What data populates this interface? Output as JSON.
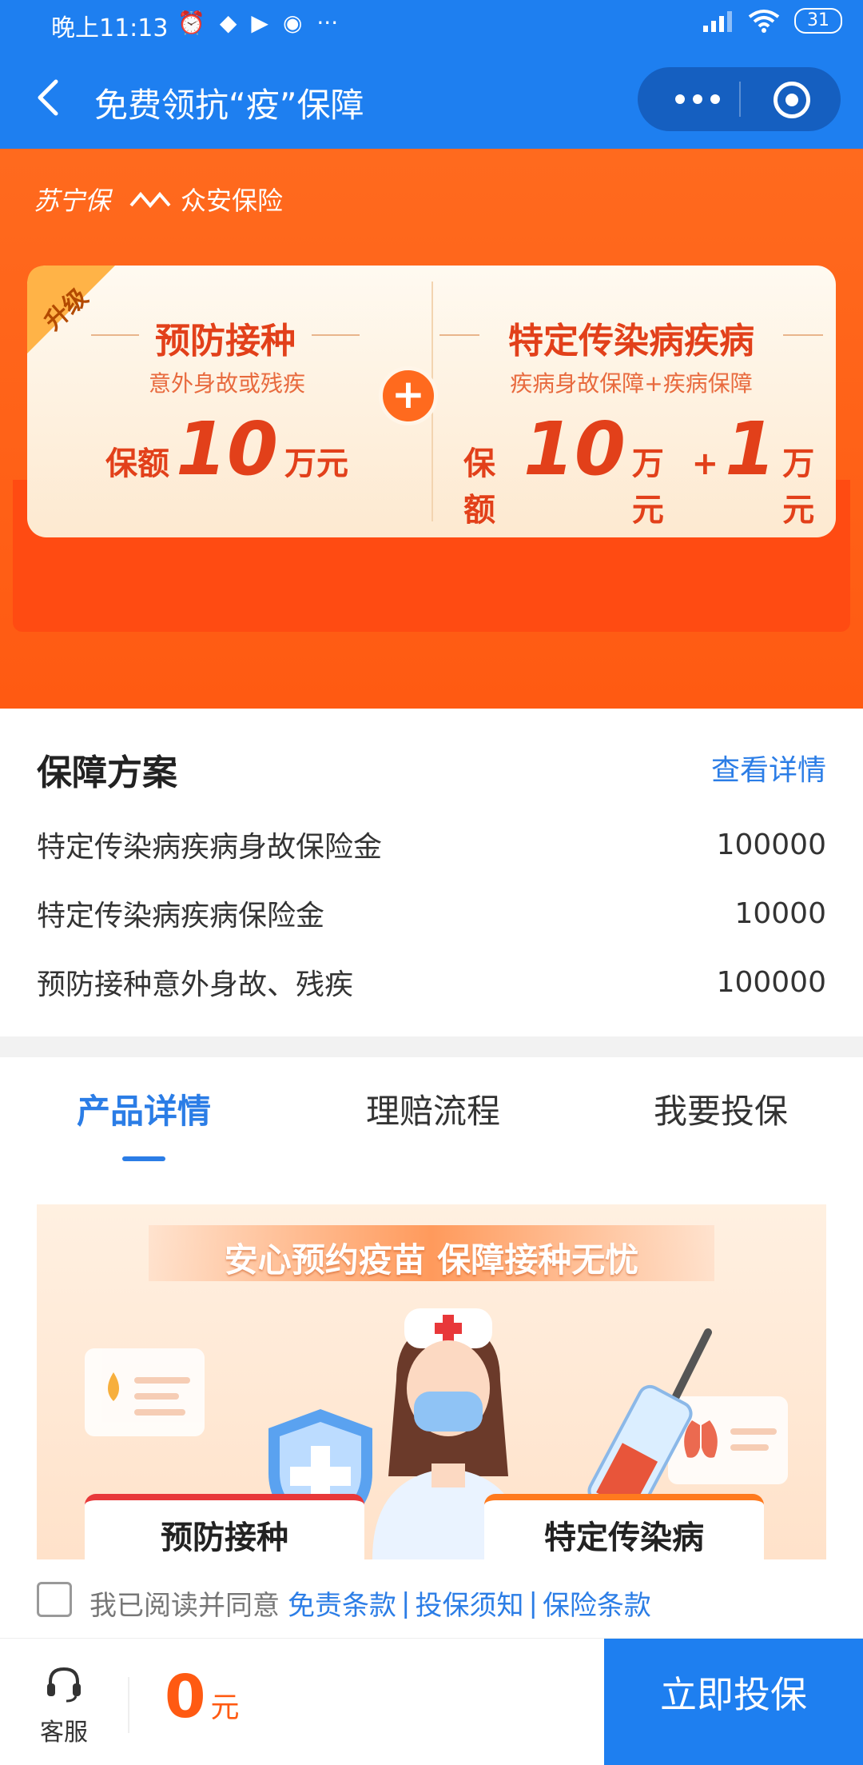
{
  "status_bar": {
    "time": "晚上11:13",
    "more": "···",
    "battery": "31"
  },
  "nav": {
    "title": "免费领抗“疫”保障"
  },
  "banner": {
    "brand_suning": "苏宁保",
    "brand_zhongan": "众安保险",
    "badge": "升级",
    "left": {
      "title": "预防接种",
      "subtitle": "意外身故或残疾",
      "amount_prefix": "保额",
      "amount": "10",
      "unit": "万元"
    },
    "plus": "+",
    "right": {
      "title": "特定传染病疾病",
      "subtitle": "疾病身故保障+疾病保障",
      "amount_prefix": "保额",
      "amount": "10",
      "unit": "万元",
      "extra_plus": "+",
      "extra_amount": "1",
      "extra_unit": "万元"
    }
  },
  "plan": {
    "title": "保障方案",
    "details_link": "查看详情",
    "rows": [
      {
        "label": "特定传染病疾病身故保险金",
        "value": "100000"
      },
      {
        "label": "特定传染病疾病保险金",
        "value": "10000"
      },
      {
        "label": "预防接种意外身故、残疾",
        "value": "100000"
      }
    ]
  },
  "tabs": [
    {
      "label": "产品详情",
      "active": true
    },
    {
      "label": "理赔流程",
      "active": false
    },
    {
      "label": "我要投保",
      "active": false
    }
  ],
  "promo": {
    "title": "安心预约疫苗  保障接种无忧",
    "card_left": "预防接种",
    "card_right": "特定传染病"
  },
  "agreement": {
    "prefix": "我已阅读并同意",
    "link1": "免责条款",
    "sep": "|",
    "link2": "投保须知",
    "link3": "保险条款"
  },
  "bottom": {
    "service_label": "客服",
    "price": "0",
    "price_unit": "元",
    "cta": "立即投保"
  },
  "colors": {
    "primary_blue": "#1e7ff0",
    "orange": "#ff5a12",
    "link_blue": "#2b7de6"
  }
}
